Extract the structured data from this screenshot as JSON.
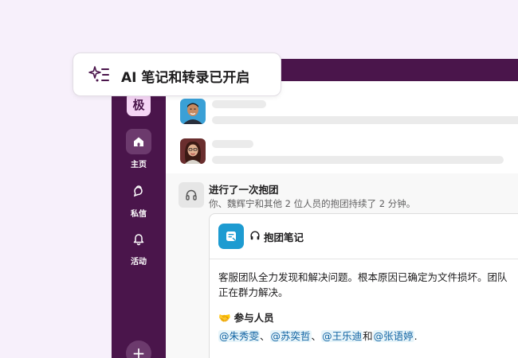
{
  "badge": {
    "icon": "sparkle-list-icon",
    "text": "AI 笔记和转录已开启"
  },
  "sidebar": {
    "workspace_initial": "极",
    "items": [
      {
        "label": "主页",
        "icon": "home-icon",
        "active": true
      },
      {
        "label": "私信",
        "icon": "direct-messages-icon",
        "active": false
      },
      {
        "label": "活动",
        "icon": "bell-icon",
        "active": false
      }
    ],
    "add_icon": "plus-icon"
  },
  "huddle": {
    "icon": "headphones-icon",
    "title": "进行了一次抱团",
    "subtitle": "你、魏辉宁和其他 2 位人员的抱团持续了 2 分钟。"
  },
  "notes_card": {
    "icon": "canvas-icon",
    "title": "抱团笔记",
    "summary": "客服团队全力发现和解决问题。根本原因已确定为文件损坏。团队正在群力解决。",
    "participants_title": "参与人员",
    "participants_emoji": "🤝",
    "mentions": [
      "@朱秀雯",
      "@苏奕哲",
      "@王乐迪",
      "@张语婷"
    ],
    "sep1": "、",
    "sep2": "、",
    "sep3": "和",
    "end": "."
  },
  "colors": {
    "aubergine": "#4a154b",
    "page_bg": "#f7f0fb",
    "mention_blue": "#1264a3",
    "canvas_blue": "#1d9bd1"
  }
}
